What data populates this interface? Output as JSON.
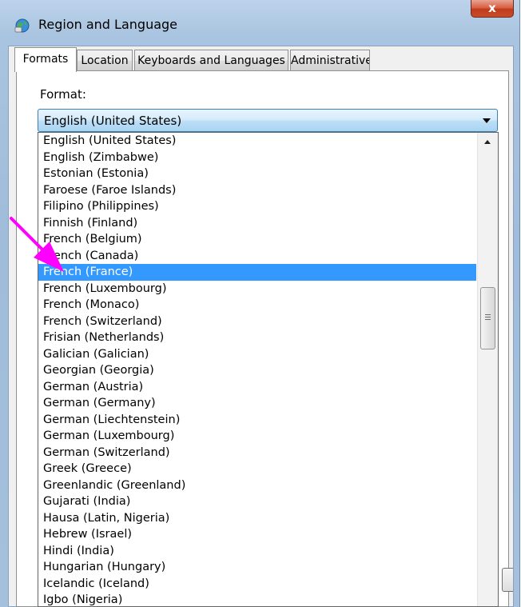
{
  "window": {
    "title": "Region and Language",
    "close_glyph": "x"
  },
  "tabs": [
    {
      "label": "Formats",
      "active": true
    },
    {
      "label": "Location",
      "active": false
    },
    {
      "label": "Keyboards and Languages",
      "active": false
    },
    {
      "label": "Administrative",
      "active": false
    }
  ],
  "format": {
    "label": "Format:",
    "selected_value": "English (United States)"
  },
  "dropdown": {
    "items": [
      "English (United States)",
      "English (Zimbabwe)",
      "Estonian (Estonia)",
      "Faroese (Faroe Islands)",
      "Filipino (Philippines)",
      "Finnish (Finland)",
      "French (Belgium)",
      "French (Canada)",
      "French (France)",
      "French (Luxembourg)",
      "French (Monaco)",
      "French (Switzerland)",
      "Frisian (Netherlands)",
      "Galician (Galician)",
      "Georgian (Georgia)",
      "German (Austria)",
      "German (Germany)",
      "German (Liechtenstein)",
      "German (Luxembourg)",
      "German (Switzerland)",
      "Greek (Greece)",
      "Greenlandic (Greenland)",
      "Gujarati (India)",
      "Hausa (Latin, Nigeria)",
      "Hebrew (Israel)",
      "Hindi (India)",
      "Hungarian (Hungary)",
      "Icelandic (Iceland)",
      "Igbo (Nigeria)"
    ],
    "highlighted_item": "French (France)",
    "scrollbar_thumb_grip": "≡"
  },
  "icons": {
    "title_icon": "globe-icon",
    "annotation": "magenta-arrow-icon"
  },
  "colors": {
    "selection": "#3399ff",
    "annotation_arrow": "#ff00ff",
    "close_button": "#c8452a",
    "titlebar": "#a9c4e0"
  }
}
